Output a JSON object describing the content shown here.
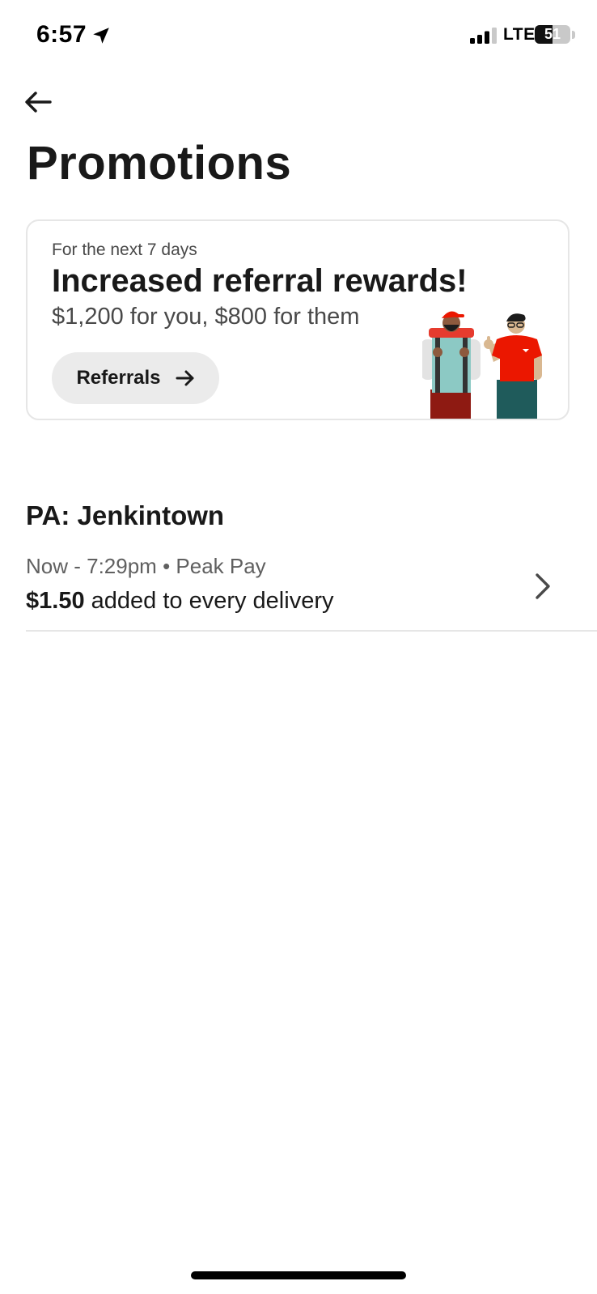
{
  "status_bar": {
    "time": "6:57",
    "network": "LTE",
    "battery_level": "51",
    "battery_percent": 51,
    "icons": [
      "location-arrow-icon",
      "signal-icon",
      "battery-icon"
    ]
  },
  "header": {
    "back_icon": "arrow-left-icon",
    "title": "Promotions"
  },
  "promo_card": {
    "eyebrow": "For the next 7 days",
    "headline": "Increased referral rewards!",
    "subline": "$1,200 for you, $800 for them",
    "button_label": "Referrals",
    "button_icon": "arrow-right-icon",
    "illustration": "two-dashers-illustration"
  },
  "zone": {
    "title": "PA: Jenkintown",
    "promotions": [
      {
        "meta": "Now - 7:29pm • Peak Pay",
        "amount": "$1.50",
        "description": " added to every delivery",
        "icon": "chevron-right-icon"
      }
    ]
  },
  "colors": {
    "text_primary": "#191919",
    "text_secondary": "#606060",
    "card_border": "#e6e6e6",
    "button_bg": "#ebebeb",
    "brand_red": "#eb1700"
  }
}
